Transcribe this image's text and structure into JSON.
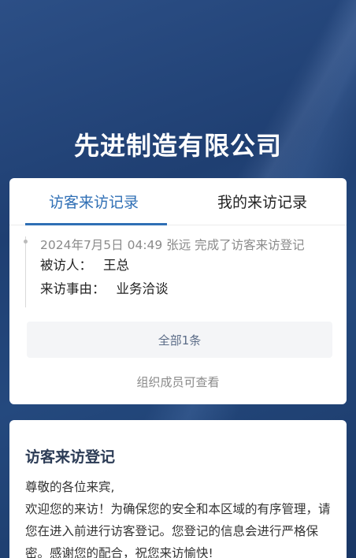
{
  "company": {
    "name": "先进制造有限公司"
  },
  "tabs": [
    {
      "label": "访客来访记录",
      "active": true
    },
    {
      "label": "我的来访记录",
      "active": false
    }
  ],
  "record": {
    "header": "2024年7月5日 04:49  张远  完成了访客来访登记",
    "visited_label": "被访人：",
    "visited_value": "王总",
    "reason_label": "来访事由：",
    "reason_value": "业务洽谈"
  },
  "all_button": {
    "label": "全部1条"
  },
  "note": "组织成员可查看",
  "register": {
    "title": "访客来访登记",
    "greeting": "尊敬的各位来宾,",
    "body": "欢迎您的来访！为确保您的安全和本区域的有序管理，请您在进入前进行访客登记。您登记的信息会进行严格保密。感谢您的配合，祝您来访愉快!"
  },
  "colors": {
    "accent": "#2f6fb5",
    "background": "#1f3f72"
  }
}
